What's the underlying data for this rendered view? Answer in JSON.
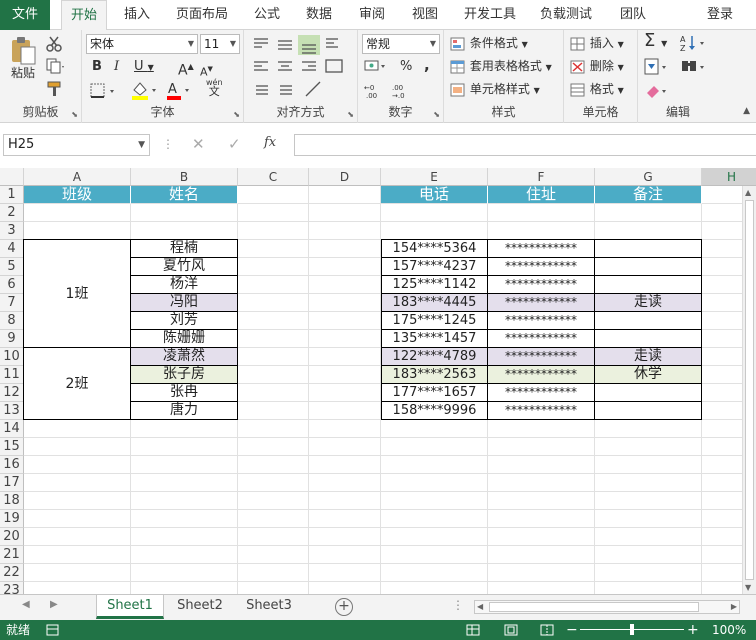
{
  "tabs": {
    "file": "文件",
    "home": "开始",
    "insert": "插入",
    "layout": "页面布局",
    "formulas": "公式",
    "data": "数据",
    "review": "审阅",
    "view": "视图",
    "developer": "开发工具",
    "loadtest": "负载测试",
    "team": "团队",
    "login": "登录"
  },
  "ribbon": {
    "clipboard": {
      "label": "剪贴板",
      "paste": "粘贴"
    },
    "font": {
      "label": "字体",
      "name": "宋体",
      "size": "11",
      "wen": "wén",
      "wenchar": "文"
    },
    "alignment": {
      "label": "对齐方式"
    },
    "number": {
      "label": "数字",
      "format": "常规",
      "percent": "%",
      "comma": ","
    },
    "styles": {
      "label": "样式",
      "conditional": "条件格式",
      "table": "套用表格格式",
      "cell": "单元格样式"
    },
    "cells": {
      "label": "单元格",
      "insert": "插入",
      "delete": "删除",
      "format": "格式"
    },
    "editing": {
      "label": "编辑"
    }
  },
  "formula": {
    "namebox": "H25",
    "fx": "fx",
    "value": ""
  },
  "columns": [
    "A",
    "B",
    "C",
    "D",
    "E",
    "F",
    "G",
    "H"
  ],
  "rows": [
    "1",
    "2",
    "3",
    "4",
    "5",
    "6",
    "7",
    "8",
    "9",
    "10",
    "11",
    "12",
    "13",
    "14",
    "15",
    "16",
    "17",
    "18",
    "19",
    "20",
    "21",
    "22",
    "23"
  ],
  "header": {
    "class": "班级",
    "name": "姓名",
    "phone": "电话",
    "address": "住址",
    "note": "备注"
  },
  "groups": [
    "1班",
    "2班"
  ],
  "names": [
    "程楠",
    "夏竹风",
    "杨洋",
    "冯阳",
    "刘芳",
    "陈姗姗",
    "凌萧然",
    "张子房",
    "张冉",
    "唐力"
  ],
  "phones": [
    "154****5364",
    "157****4237",
    "125****1142",
    "183****4445",
    "175****1245",
    "135****1457",
    "122****4789",
    "183****2563",
    "177****1657",
    "158****9996"
  ],
  "address_mask": "************",
  "notes": [
    "",
    "",
    "",
    "走读",
    "",
    "",
    "走读",
    "休学",
    "",
    ""
  ],
  "colors": {
    "header_bg": "#4bacc6",
    "highlight_purple": "#e4dfec",
    "highlight_green": "#ebf1de",
    "accent": "#217346"
  },
  "sheets": [
    "Sheet1",
    "Sheet2",
    "Sheet3"
  ],
  "status": {
    "ready": "就绪",
    "zoom": "100%"
  }
}
